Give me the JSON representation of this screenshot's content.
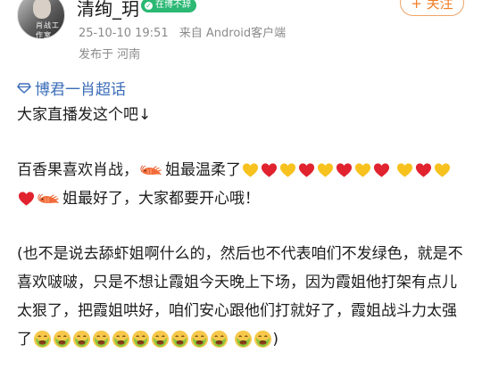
{
  "header": {
    "username": "清绚_玥",
    "badge_label": "在博不辞",
    "follow_label": "+ 关注",
    "date": "25-10-10 19:51",
    "source": "来自 Android客户端",
    "location": "发布于 河南",
    "avatar_sig": "肖战工作室"
  },
  "topic": {
    "label": "博君一肖超话"
  },
  "post": {
    "line1": "大家直播发这个吧↓",
    "para2_a": "百香果喜欢肖战，",
    "para2_b": "姐最温柔了",
    "para2_c": "姐最好了，大家都要开心哦！",
    "para3_a": "(也不是说去舔虾姐啊什么的，然后也不代表咱们不发绿色，就是不喜欢啵啵，只是不想让霞姐今天晚上下场，因为霞姐他打架有点儿太狠了，把霞姐哄好，咱们安心跟他们打就好了，霞姐战斗力太强了",
    "para3_end": ")"
  },
  "colors": {
    "link": "#3a6db8",
    "follow": "#f07d24",
    "badge": "#2ab873",
    "heart_yellow": "#f7c21e",
    "heart_red": "#e0232f"
  },
  "icons": {
    "topic": "diamond-icon",
    "shrimp": "shrimp-emoji",
    "heart_yellow": "yellow-heart-emoji",
    "heart_red": "red-heart-emoji",
    "sick": "nauseated-face-emoji"
  }
}
